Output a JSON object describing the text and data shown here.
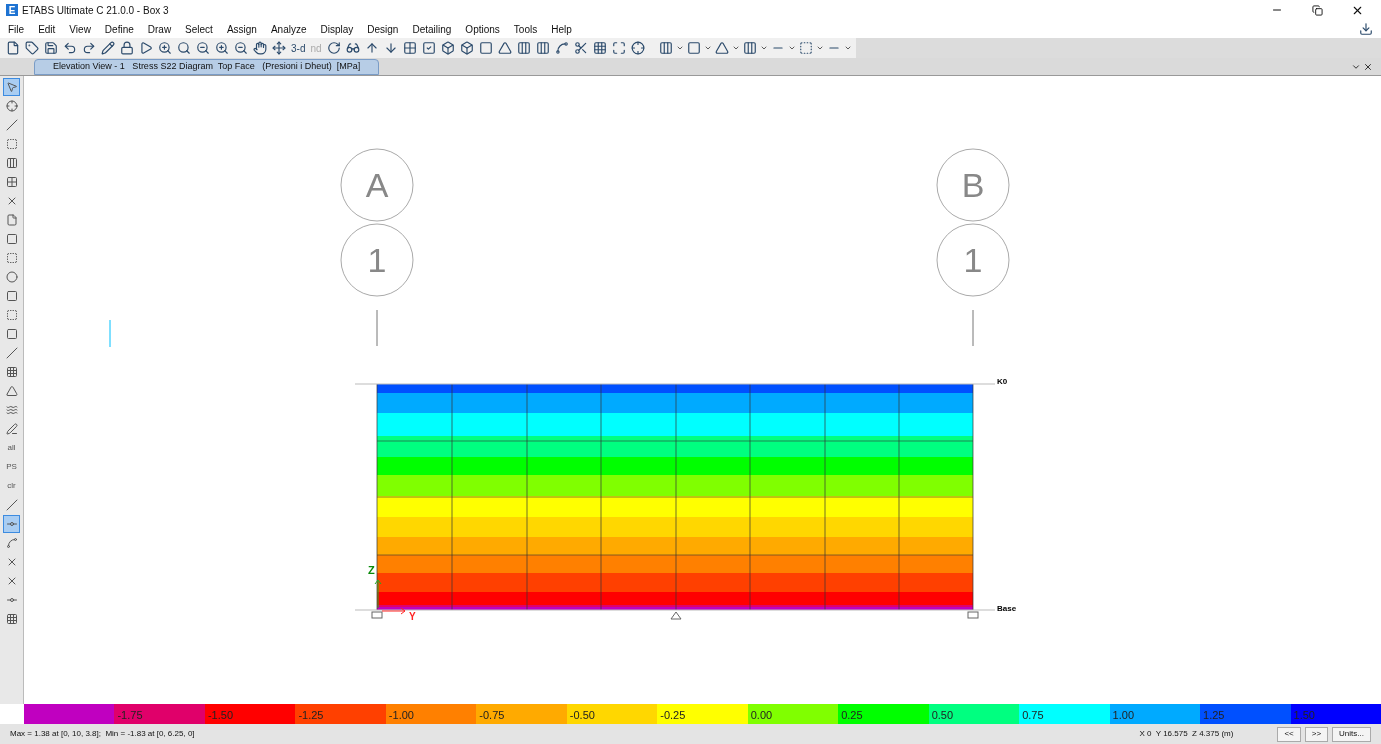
{
  "window": {
    "title": "ETABS Ultimate C 21.0.0 - Box 3",
    "logo": "E"
  },
  "menu": [
    "File",
    "Edit",
    "View",
    "Define",
    "Draw",
    "Select",
    "Assign",
    "Analyze",
    "Display",
    "Design",
    "Detailing",
    "Options",
    "Tools",
    "Help"
  ],
  "toolbar_text_buttons": [
    {
      "label": "3-d",
      "disabled": false
    },
    {
      "label": "nd",
      "disabled": true
    }
  ],
  "tabs": [
    {
      "label": "Elevation View - 1   Stress S22 Diagram  Top Face   (Presioni i Dheut)  [MPa]",
      "selected": true
    }
  ],
  "left_toolbar": [
    {
      "selected": true
    },
    {
      "selected": false
    },
    {
      "selected": false
    },
    {
      "selected": false
    },
    {
      "selected": false
    },
    {
      "selected": false
    },
    {
      "selected": false
    },
    {
      "selected": false
    },
    {
      "selected": false
    },
    {
      "selected": false
    },
    {
      "selected": false
    },
    {
      "selected": false
    },
    {
      "selected": false
    },
    {
      "selected": false
    },
    {
      "selected": false
    },
    {
      "selected": false
    },
    {
      "selected": false
    },
    {
      "selected": false
    },
    {
      "selected": false
    },
    {
      "selected": false,
      "label": "all"
    },
    {
      "selected": false,
      "label": "PS"
    },
    {
      "selected": false,
      "label": "clr"
    },
    {
      "selected": false
    },
    {
      "selected": true
    },
    {
      "selected": false
    },
    {
      "selected": false
    },
    {
      "selected": false
    },
    {
      "selected": false
    },
    {
      "selected": false
    }
  ],
  "grid_bubbles": [
    {
      "column": "A",
      "row": "1"
    },
    {
      "column": "B",
      "row": "1"
    }
  ],
  "stories": [
    "K0",
    "Base"
  ],
  "axes": [
    "Z",
    "Y"
  ],
  "legend": {
    "swatches": [
      {
        "color": "#c000c0"
      },
      {
        "color": "#e0006a"
      },
      {
        "color": "#ff0000"
      },
      {
        "color": "#ff4000"
      },
      {
        "color": "#ff8000"
      },
      {
        "color": "#ffaa00"
      },
      {
        "color": "#ffd700"
      },
      {
        "color": "#ffff00"
      },
      {
        "color": "#80ff00"
      },
      {
        "color": "#00ff00"
      },
      {
        "color": "#00ff80"
      },
      {
        "color": "#00ffff"
      },
      {
        "color": "#00aaff"
      },
      {
        "color": "#0050ff"
      },
      {
        "color": "#0000ff"
      }
    ],
    "ticks": [
      "-1.75",
      "-1.50",
      "-1.25",
      "-1.00",
      "-0.75",
      "-0.50",
      "-0.25",
      "0.00",
      "0.25",
      "0.50",
      "0.75",
      "1.00",
      "1.25",
      "1.50"
    ]
  },
  "status_bar": {
    "extremes": "Max = 1.38 at [0, 10, 3.8];  Min = -1.83 at [0, 6.25, 0]",
    "coordinates": "X 0  Y 16.575  Z 4.375 (m)",
    "buttons": [
      "<<",
      ">>",
      "Units..."
    ]
  }
}
